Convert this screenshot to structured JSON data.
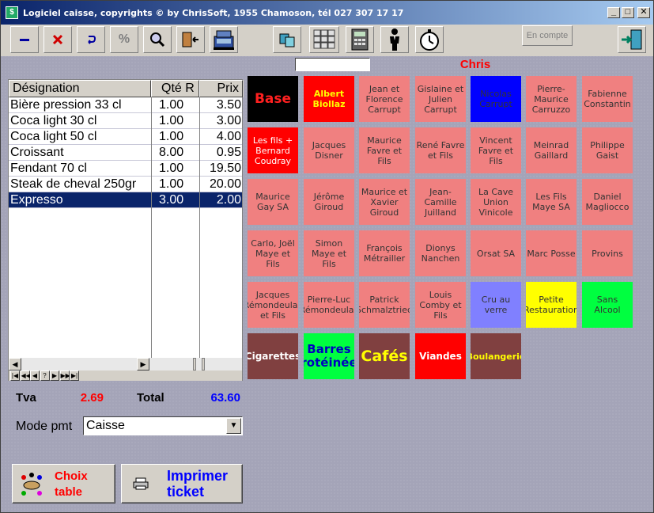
{
  "window": {
    "title": "Logiciel caisse, copyrights © by ChrisSoft, 1955 Chamoson, tél 027 307 17 17"
  },
  "toolbar": {
    "en_compte_label": "En compte",
    "percent_label": "%"
  },
  "user": {
    "name": "Chris",
    "field_value": ""
  },
  "grid": {
    "columns": [
      "Désignation",
      "Qté R",
      "Prix"
    ],
    "rows": [
      {
        "name": "Bière pression 33 cl",
        "qty": "1.00",
        "price": "3.50"
      },
      {
        "name": "Coca light 30 cl",
        "qty": "1.00",
        "price": "3.00"
      },
      {
        "name": "Coca light 50 cl",
        "qty": "1.00",
        "price": "4.00"
      },
      {
        "name": "Croissant",
        "qty": "8.00",
        "price": "0.95"
      },
      {
        "name": "Fendant 70 cl",
        "qty": "1.00",
        "price": "19.50"
      },
      {
        "name": "Steak de cheval 250gr",
        "qty": "1.00",
        "price": "20.00"
      },
      {
        "name": "Expresso",
        "qty": "3.00",
        "price": "2.00"
      }
    ],
    "selected_row": 6,
    "nav_labels": [
      "|◀",
      "◀◀",
      "◀",
      "?",
      "▶",
      "▶▶",
      "▶|"
    ]
  },
  "totals": {
    "tva_label": "Tva",
    "tva_value": "2.69",
    "total_label": "Total",
    "total_value": "63.60"
  },
  "payment": {
    "label": "Mode pmt",
    "selected": "Caisse"
  },
  "actions": {
    "choix_table_line1": "Choix",
    "choix_table_line2": "table",
    "imprimer_line1": "Imprimer",
    "imprimer_line2": "ticket"
  },
  "tiles": [
    {
      "label": "Base",
      "bg": "#000000",
      "fg": "#ff2020",
      "bold": true,
      "size": 17
    },
    {
      "label": "Albert Biollaz",
      "bg": "#ff0000",
      "fg": "#ffff00",
      "bold": true,
      "size": 11
    },
    {
      "label": "Jean et Florence Carrupt",
      "bg": "#f08080",
      "fg": "#333333"
    },
    {
      "label": "Gislaine et Julien Carrupt",
      "bg": "#f08080",
      "fg": "#333333"
    },
    {
      "label": "Nicolas Carrupt",
      "bg": "#0000ff",
      "fg": "#333333"
    },
    {
      "label": "Pierre-Maurice Carruzzo",
      "bg": "#f08080",
      "fg": "#333333"
    },
    {
      "label": "Fabienne Constantin",
      "bg": "#f08080",
      "fg": "#333333"
    },
    {
      "label": "Les fils + Bernard Coudray",
      "bg": "#ff0000",
      "fg": "#ffffff"
    },
    {
      "label": "Jacques Disner",
      "bg": "#f08080",
      "fg": "#333333"
    },
    {
      "label": "Maurice Favre et Fils",
      "bg": "#f08080",
      "fg": "#333333"
    },
    {
      "label": "René Favre et Fils",
      "bg": "#f08080",
      "fg": "#333333"
    },
    {
      "label": "Vincent Favre et Fils",
      "bg": "#f08080",
      "fg": "#333333"
    },
    {
      "label": "Meinrad Gaillard",
      "bg": "#f08080",
      "fg": "#333333"
    },
    {
      "label": "Philippe Gaist",
      "bg": "#f08080",
      "fg": "#333333"
    },
    {
      "label": "Maurice Gay SA",
      "bg": "#f08080",
      "fg": "#333333"
    },
    {
      "label": "Jérôme Giroud",
      "bg": "#f08080",
      "fg": "#333333"
    },
    {
      "label": "Maurice et Xavier Giroud",
      "bg": "#f08080",
      "fg": "#333333"
    },
    {
      "label": "Jean-Camille Juilland",
      "bg": "#f08080",
      "fg": "#333333"
    },
    {
      "label": "La Cave Union Vinicole",
      "bg": "#f08080",
      "fg": "#333333"
    },
    {
      "label": "Les Fils Maye SA",
      "bg": "#f08080",
      "fg": "#333333"
    },
    {
      "label": "Daniel Magliocco",
      "bg": "#f08080",
      "fg": "#333333"
    },
    {
      "label": "Carlo, Joël Maye et Fils",
      "bg": "#f08080",
      "fg": "#333333"
    },
    {
      "label": "Simon Maye et Fils",
      "bg": "#f08080",
      "fg": "#333333"
    },
    {
      "label": "François Métrailler",
      "bg": "#f08080",
      "fg": "#333333"
    },
    {
      "label": "Dionys Nanchen",
      "bg": "#f08080",
      "fg": "#333333"
    },
    {
      "label": "Orsat SA",
      "bg": "#f08080",
      "fg": "#333333"
    },
    {
      "label": "Marc Posse",
      "bg": "#f08080",
      "fg": "#333333"
    },
    {
      "label": "Provins",
      "bg": "#f08080",
      "fg": "#333333"
    },
    {
      "label": "Jacques Rémondeulaz et Fils",
      "bg": "#f08080",
      "fg": "#333333"
    },
    {
      "label": "Pierre-Luc Rémondeulaz",
      "bg": "#f08080",
      "fg": "#333333"
    },
    {
      "label": "Patrick Schmalztried",
      "bg": "#f08080",
      "fg": "#333333"
    },
    {
      "label": "Louis Comby et Fils",
      "bg": "#f08080",
      "fg": "#333333"
    },
    {
      "label": "Cru au verre",
      "bg": "#8080ff",
      "fg": "#333333"
    },
    {
      "label": "Petite Restauration",
      "bg": "#ffff00",
      "fg": "#333333"
    },
    {
      "label": "Sans Alcool",
      "bg": "#00ff40",
      "fg": "#333333"
    },
    {
      "label": "Cigarettes",
      "bg": "#804040",
      "fg": "#ffffff",
      "bold": true,
      "size": 12
    },
    {
      "label": "Barres rotéinée",
      "bg": "#00ff40",
      "fg": "#0000c0",
      "bold": true,
      "size": 15
    },
    {
      "label": "Cafés",
      "bg": "#804040",
      "fg": "#ffff00",
      "bold": true,
      "size": 19
    },
    {
      "label": "Viandes",
      "bg": "#ff0000",
      "fg": "#ffffff",
      "bold": true,
      "size": 12
    },
    {
      "label": "Boulangerie",
      "bg": "#804040",
      "fg": "#ffff00",
      "bold": true,
      "size": 11
    }
  ]
}
